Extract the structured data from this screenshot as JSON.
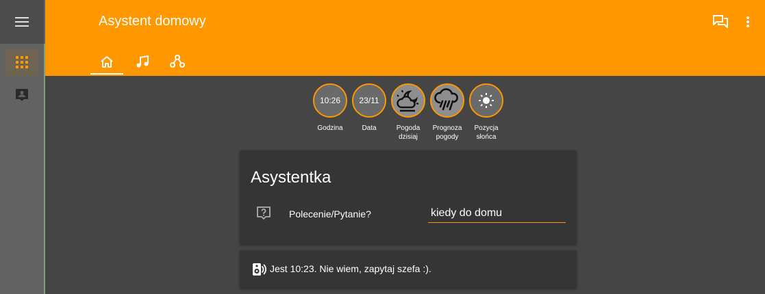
{
  "header": {
    "title": "Asystent domowy",
    "accent_color": "#ff9800",
    "actions": [
      {
        "icon": "chat-bubbles-icon"
      },
      {
        "icon": "more-vert-icon"
      }
    ],
    "tabs": [
      {
        "icon": "home-icon",
        "active": true
      },
      {
        "icon": "music-note-icon",
        "active": false
      },
      {
        "icon": "hub-icon",
        "active": false
      }
    ]
  },
  "sidebar": {
    "menu_icon": "menu-icon",
    "items": [
      {
        "icon": "grid-icon",
        "active": true
      },
      {
        "icon": "contact-card-icon",
        "active": false
      }
    ]
  },
  "badges": [
    {
      "value": "10:26",
      "label": "Godzina"
    },
    {
      "value": "23/11",
      "label": "Data"
    },
    {
      "icon": "partly-cloudy-night-icon",
      "label": "Pogoda dzisiaj"
    },
    {
      "icon": "pouring-rain-icon",
      "label": "Prognoza pogody"
    },
    {
      "icon": "sun-icon",
      "label": "Pozycja słońca"
    }
  ],
  "assistant_card": {
    "title": "Asystentka",
    "question_label": "Polecenie/Pytanie?",
    "question_value": "kiedy do domu",
    "question_icon": "help-bubble-icon"
  },
  "result": {
    "icon": "speaker-icon",
    "text": "Jest 10:23. Nie wiem, zapytaj szefa :)."
  }
}
